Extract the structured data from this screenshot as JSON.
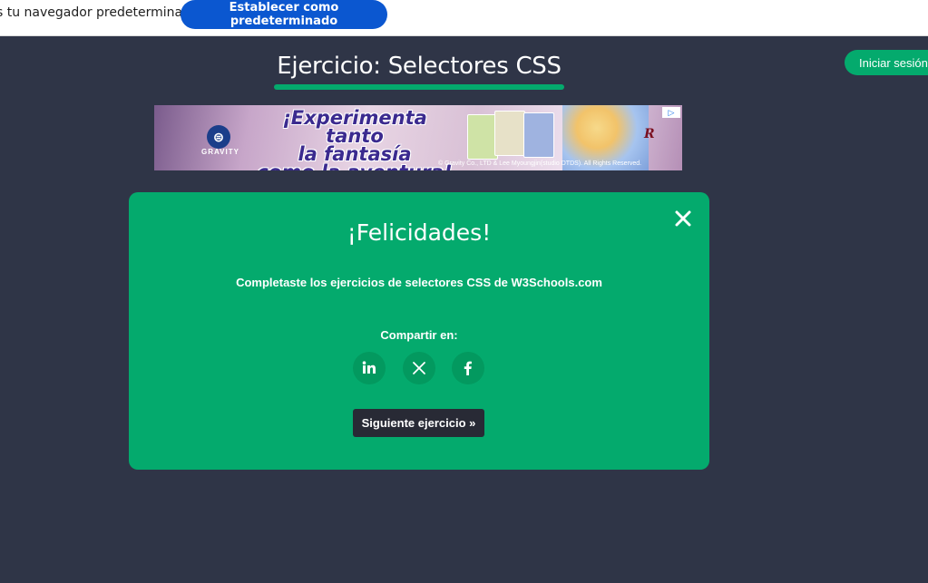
{
  "infobar": {
    "message": "s tu navegador predeterminado",
    "button_label": "Establecer como predeterminado"
  },
  "header": {
    "login_label": "Iniciar sesión"
  },
  "page": {
    "title": "Ejercicio: Selectores CSS"
  },
  "ad": {
    "brand": "GRAVITY",
    "headline_line1": "¡Experimenta tanto",
    "headline_line2": "la fantasía",
    "headline_line3": "como la aventura!",
    "copyright": "© Gravity Co., LTD & Lee Myoungjin(studio DTDS). All Rights Reserved.",
    "adchoices_icon": "adchoices-icon"
  },
  "modal": {
    "title": "¡Felicidades!",
    "message": "Completaste los ejercicios de selectores CSS de W3Schools.com",
    "share_label": "Compartir en:",
    "share_icons": [
      "linkedin-icon",
      "x-icon",
      "facebook-icon"
    ],
    "next_label": "Siguiente ejercicio »",
    "close_icon": "close-icon"
  },
  "colors": {
    "background": "#2f3547",
    "accent_green": "#04aa6d",
    "infobar_button": "#0b57d0",
    "dark_button": "#282a35"
  }
}
